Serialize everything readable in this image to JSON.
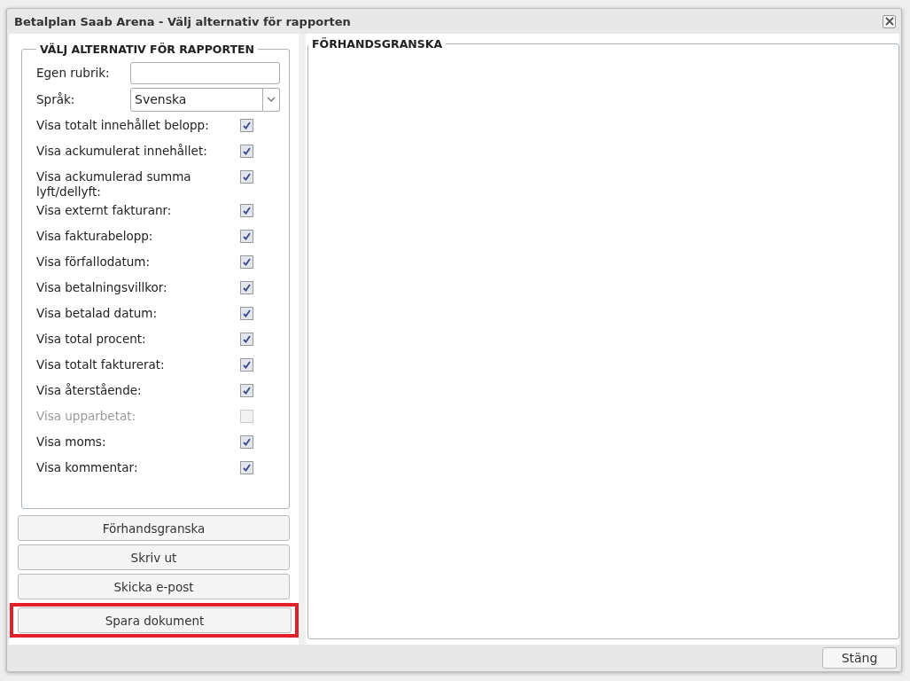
{
  "window": {
    "title": "Betalplan Saab Arena - Välj alternativ för rapporten"
  },
  "options": {
    "legend": "VÄLJ ALTERNATIV FÖR RAPPORTEN",
    "title_field": {
      "label": "Egen rubrik:"
    },
    "language": {
      "label": "Språk:",
      "value": "Svenska"
    },
    "checkboxes": [
      {
        "label": "Visa totalt innehållet belopp:",
        "checked": true,
        "disabled": false
      },
      {
        "label": "Visa ackumulerat innehållet:",
        "checked": true,
        "disabled": false
      },
      {
        "label": "Visa ackumulerad summa lyft/dellyft:",
        "checked": true,
        "disabled": false
      },
      {
        "label": "Visa externt fakturanr:",
        "checked": true,
        "disabled": false
      },
      {
        "label": "Visa fakturabelopp:",
        "checked": true,
        "disabled": false
      },
      {
        "label": "Visa förfallodatum:",
        "checked": true,
        "disabled": false
      },
      {
        "label": "Visa betalningsvillkor:",
        "checked": true,
        "disabled": false
      },
      {
        "label": "Visa betalad datum:",
        "checked": true,
        "disabled": false
      },
      {
        "label": "Visa total procent:",
        "checked": true,
        "disabled": false
      },
      {
        "label": "Visa totalt fakturerat:",
        "checked": true,
        "disabled": false
      },
      {
        "label": "Visa återstående:",
        "checked": true,
        "disabled": false
      },
      {
        "label": "Visa upparbetat:",
        "checked": false,
        "disabled": true
      },
      {
        "label": "Visa moms:",
        "checked": true,
        "disabled": false
      },
      {
        "label": "Visa kommentar:",
        "checked": true,
        "disabled": false
      }
    ]
  },
  "actions": [
    {
      "label": "Förhandsgranska",
      "highlighted": false
    },
    {
      "label": "Skriv ut",
      "highlighted": false
    },
    {
      "label": "Skicka e-post",
      "highlighted": false
    },
    {
      "label": "Spara dokument",
      "highlighted": true
    }
  ],
  "preview": {
    "legend": "FÖRHANDSGRANSKA"
  },
  "footer": {
    "close_button": "Stäng"
  }
}
